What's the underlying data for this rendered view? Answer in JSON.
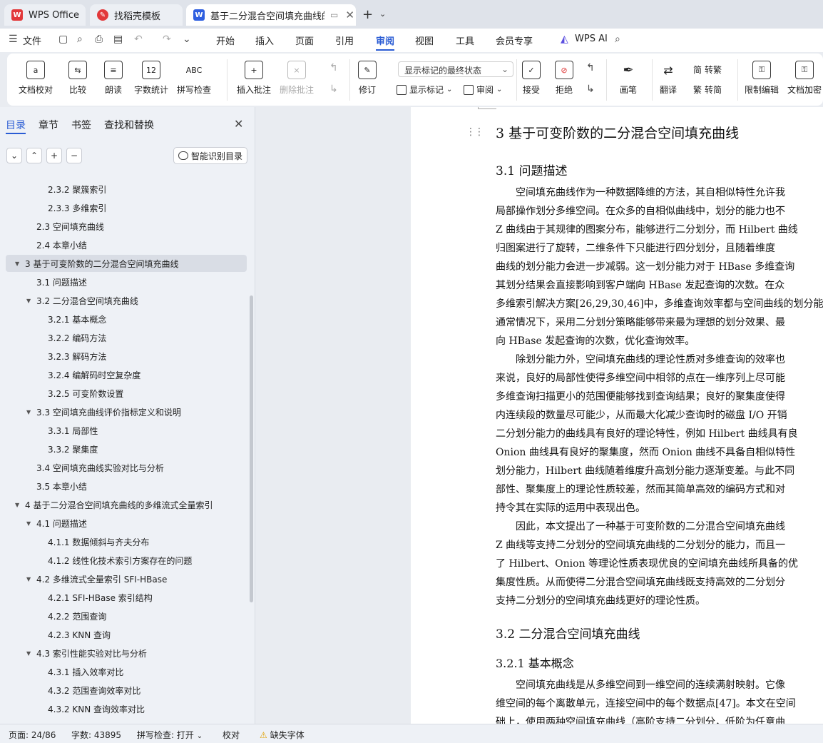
{
  "tabs": {
    "wps": "WPS Office",
    "template": "找稻壳模板",
    "doc": "基于二分混合空间填充曲线的HBase",
    "new": "+"
  },
  "menu": {
    "file": "文件",
    "items": [
      "开始",
      "插入",
      "页面",
      "引用",
      "审阅",
      "视图",
      "工具",
      "会员专享"
    ],
    "active": "审阅",
    "ai": "WPS AI"
  },
  "ribbon": {
    "doc_check": "文档校对",
    "compare": "比较",
    "read_aloud": "朗读",
    "word_count": "字数统计",
    "spell_check": "拼写检查",
    "insert_comment": "插入批注",
    "delete_comment": "删除批注",
    "revise": "修订",
    "display_mode": "显示标记的最终状态",
    "show_markup": "显示标记",
    "review": "审阅",
    "accept": "接受",
    "reject": "拒绝",
    "pen": "画笔",
    "translate": "翻译",
    "to_traditional": "转繁",
    "to_simplified": "转简",
    "restrict_edit": "限制编辑",
    "encrypt": "文档加密",
    "spell_icon": "ABC",
    "count_icon": "12"
  },
  "sidebar": {
    "tabs": [
      "目录",
      "章节",
      "书签",
      "查找和替换"
    ],
    "smart_button": "智能识别目录",
    "toc": [
      {
        "text": "2.3.2  聚簇索引",
        "level": 3
      },
      {
        "text": "2.3.3  多维索引",
        "level": 3
      },
      {
        "text": "2.3  空间填充曲线",
        "level": 2
      },
      {
        "text": "2.4  本章小结",
        "level": 2
      },
      {
        "text": "3  基于可变阶数的二分混合空间填充曲线",
        "level": 1,
        "expanded": true,
        "selected": true
      },
      {
        "text": "3.1  问题描述",
        "level": 2
      },
      {
        "text": "3.2  二分混合空间填充曲线",
        "level": 2,
        "expanded": true
      },
      {
        "text": "3.2.1  基本概念",
        "level": 3
      },
      {
        "text": "3.2.2  编码方法",
        "level": 3
      },
      {
        "text": "3.2.3  解码方法",
        "level": 3
      },
      {
        "text": "3.2.4  编解码时空复杂度",
        "level": 3
      },
      {
        "text": "3.2.5  可变阶数设置",
        "level": 3
      },
      {
        "text": "3.3  空间填充曲线评价指标定义和说明",
        "level": 2,
        "expanded": true
      },
      {
        "text": "3.3.1  局部性",
        "level": 3
      },
      {
        "text": "3.3.2  聚集度",
        "level": 3
      },
      {
        "text": "3.4  空间填充曲线实验对比与分析",
        "level": 2
      },
      {
        "text": "3.5  本章小结",
        "level": 2
      },
      {
        "text": "4  基于二分混合空间填充曲线的多维流式全量索引",
        "level": 1,
        "expanded": true
      },
      {
        "text": "4.1  问题描述",
        "level": 2,
        "expanded": true
      },
      {
        "text": "4.1.1  数据倾斜与齐夫分布",
        "level": 3
      },
      {
        "text": "4.1.2  线性化技术索引方案存在的问题",
        "level": 3
      },
      {
        "text": "4.2 多维流式全量索引 SFI-HBase",
        "level": 2,
        "expanded": true
      },
      {
        "text": "4.2.1 SFI-HBase 索引结构",
        "level": 3
      },
      {
        "text": "4.2.2  范围查询",
        "level": 3
      },
      {
        "text": "4.2.3 KNN 查询",
        "level": 3
      },
      {
        "text": "4.3 索引性能实验对比与分析",
        "level": 2,
        "expanded": true
      },
      {
        "text": "4.3.1  插入效率对比",
        "level": 3
      },
      {
        "text": "4.3.2  范围查询效率对比",
        "level": 3
      },
      {
        "text": "4.3.2 KNN 查询效率对比",
        "level": 3
      }
    ]
  },
  "document": {
    "h1": "3  基于可变阶数的二分混合空间填充曲线",
    "h2_1": "3.1  问题描述",
    "p1": [
      "　　空间填充曲线作为一种数据降维的方法，其自相似特性允许我",
      "局部操作划分多维空间。在众多的自相似曲线中，划分的能力也不",
      "Z 曲线由于其规律的图案分布，能够进行二分划分，而 Hilbert 曲线",
      "归图案进行了旋转，二维条件下只能进行四分划分，且随着维度",
      "曲线的划分能力会进一步减弱。这一划分能力对于 HBase 多维查询",
      "其划分结果会直接影响到客户端向 HBase 发起查询的次数。在众",
      "多维索引解决方案[26,29,30,46]中，多维查询效率都与空间曲线的划分能",
      "通常情况下，采用二分划分策略能够带来最为理想的划分效果、最",
      "向 HBase 发起查询的次数，优化查询效率。"
    ],
    "p2": [
      "　　除划分能力外，空间填充曲线的理论性质对多维查询的效率也",
      "来说，良好的局部性使得多维空间中相邻的点在一维序列上尽可能",
      "多维查询扫描更小的范围便能够找到查询结果；良好的聚集度使得",
      "内连续段的数量尽可能少，从而最大化减少查询时的磁盘 I/O 开销",
      "二分划分能力的曲线具有良好的理论特性，例如 Hilbert 曲线具有良",
      "Onion 曲线具有良好的聚集度，然而 Onion 曲线不具备自相似特性",
      "划分能力，Hilbert 曲线随着维度升高划分能力逐渐变差。与此不同",
      "部性、聚集度上的理论性质较差，然而其简单高效的编码方式和对",
      "持令其在实际的运用中表现出色。"
    ],
    "p3": [
      "　　因此，本文提出了一种基于可变阶数的二分混合空间填充曲线",
      "Z 曲线等支持二分划分的空间填充曲线的二分划分的能力，而且一",
      "了 Hilbert、Onion 等理论性质表现优良的空间填充曲线所具备的优",
      "集度性质。从而使得二分混合空间填充曲线既支持高效的二分划分",
      "支持二分划分的空间填充曲线更好的理论性质。"
    ],
    "h2_2": "3.2  二分混合空间填充曲线",
    "h3_1": "3.2.1  基本概念",
    "p4": [
      "　　空间填充曲线是从多维空间到一维空间的连续满射映射。它像",
      "维空间的每个离散单元，连接空间中的每个数据点[47]。本文在空间",
      "础上，使用两种空间填充曲线（高阶支持二分划分，低阶为任意曲"
    ]
  },
  "status": {
    "page": "页面: 24/86",
    "words": "字数: 43895",
    "spell": "拼写检查: 打开",
    "proof": "校对",
    "missing_font": "缺失字体"
  },
  "colors": {
    "accent": "#2a5cd4",
    "wps_red": "#e2383a",
    "doc_blue": "#2f5fe0"
  }
}
